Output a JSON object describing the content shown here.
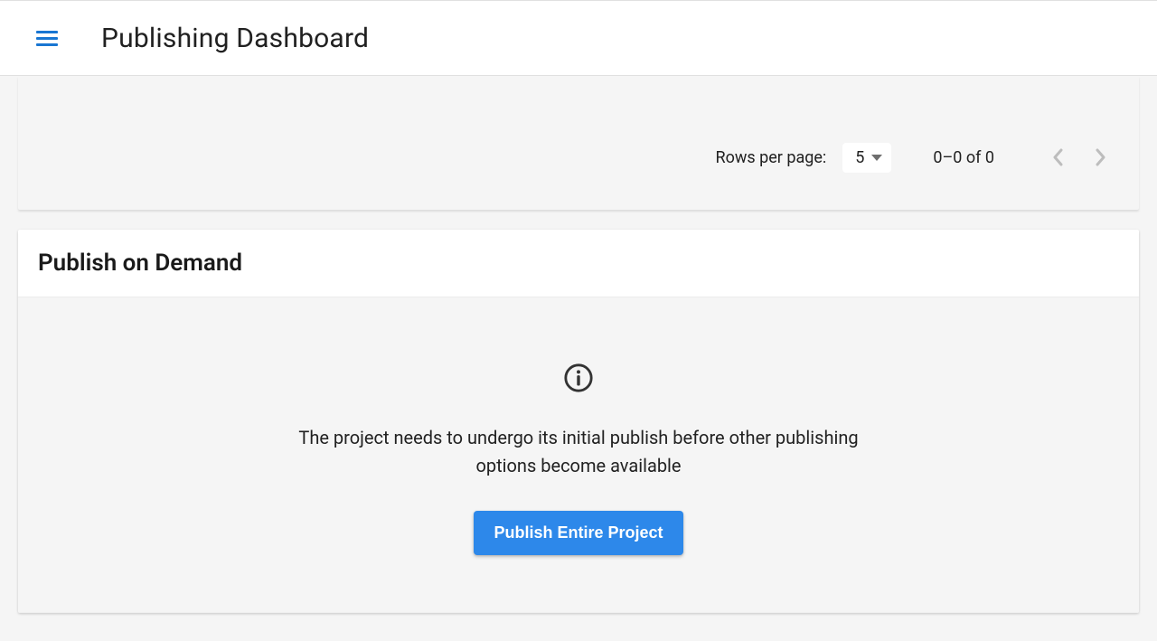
{
  "header": {
    "title": "Publishing Dashboard"
  },
  "pagination": {
    "rows_label": "Rows per page:",
    "rows_value": "5",
    "range_text": "0–0 of 0"
  },
  "publish_card": {
    "title": "Publish on Demand",
    "info_text": "The project needs to undergo its initial publish before other publishing options become available",
    "button_label": "Publish Entire Project"
  }
}
